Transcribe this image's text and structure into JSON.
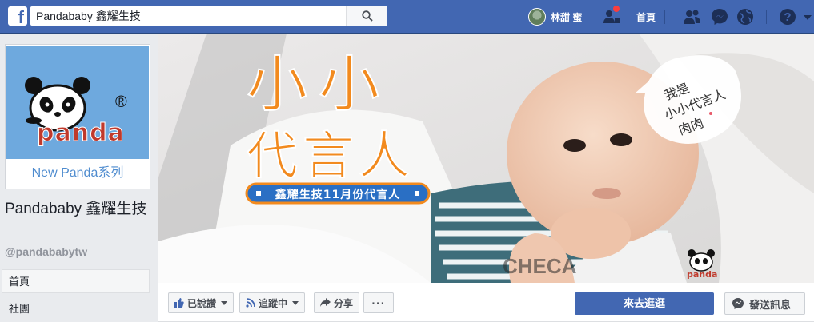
{
  "search": {
    "value": "Pandababy 鑫耀生技"
  },
  "topnav": {
    "user_name": "林甜 蜜",
    "home_label": "首頁"
  },
  "page": {
    "name": "Pandababy 鑫耀生技",
    "handle": "@pandababytw",
    "logo_word": "panda",
    "logo_registered": "®",
    "logo_caption": "New Panda系列"
  },
  "sidebar": {
    "items": [
      {
        "label": "首頁",
        "active": true
      },
      {
        "label": "社團",
        "active": false
      }
    ]
  },
  "cover": {
    "headline_line1": "小小",
    "headline_line2": "代言人",
    "banner": "鑫耀生技11月份代言人",
    "bubble_line1": "我是",
    "bubble_line2": "小小代言人",
    "bubble_line3": "肉肉",
    "shirt_text": "CHECA",
    "watermark": "panda"
  },
  "actions": {
    "liked_label": "已說讚",
    "following_label": "追蹤中",
    "share_label": "分享",
    "more_label": "···",
    "primary_label": "來去逛逛",
    "message_label": "發送訊息"
  },
  "colors": {
    "brand_blue": "#4267b2",
    "cover_orange": "#f28a1e",
    "cover_blue": "#2a6fc4",
    "notification_red": "#fa3e3e"
  }
}
